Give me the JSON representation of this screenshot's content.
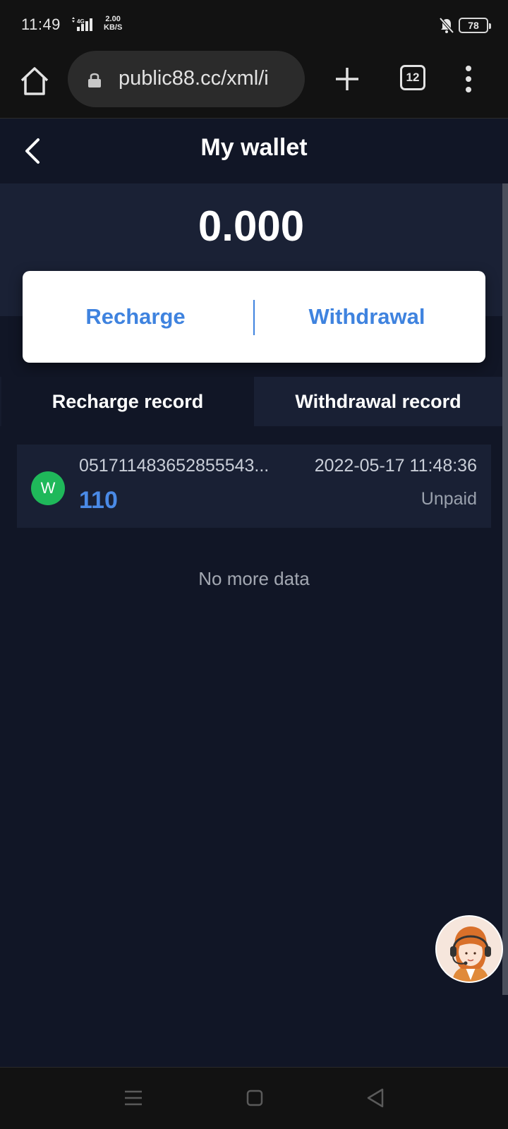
{
  "status_bar": {
    "time": "11:49",
    "speed_value": "2.00",
    "speed_unit": "KB/S",
    "network": "4G",
    "battery": "78"
  },
  "browser": {
    "url": "public88.cc/xml/i",
    "tab_count": "12"
  },
  "header": {
    "title": "My wallet"
  },
  "wallet": {
    "balance": "0.000",
    "recharge_label": "Recharge",
    "withdrawal_label": "Withdrawal"
  },
  "tabs": [
    {
      "label": "Recharge record"
    },
    {
      "label": "Withdrawal record"
    }
  ],
  "records": [
    {
      "avatar_letter": "W",
      "order_id": "051711483652855543...",
      "datetime": "2022-05-17 11:48:36",
      "amount": "110",
      "status": "Unpaid"
    }
  ],
  "list_footer": "No more data",
  "colors": {
    "accent": "#3f83df",
    "background": "#111626",
    "avatar": "#1fb85a"
  }
}
